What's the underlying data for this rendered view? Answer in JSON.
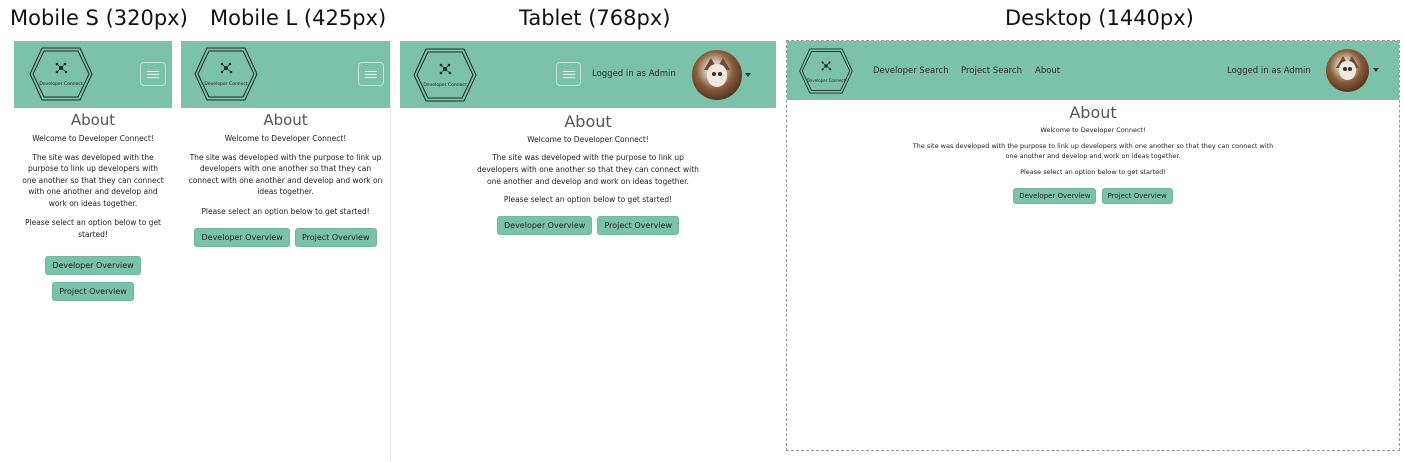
{
  "titles": {
    "mobile_s": "Mobile S (320px)",
    "mobile_l": "Mobile L (425px)",
    "tablet": "Tablet (768px)",
    "desktop": "Desktop (1440px)"
  },
  "brand": {
    "logo_text": "Developer Connect",
    "navbar_color": "#7cc1a9",
    "button_color": "#7cc1a9"
  },
  "nav": {
    "developer_search": "Developer Search",
    "project_search": "Project Search",
    "about": "About",
    "logged_in": "Logged in as Admin"
  },
  "about": {
    "heading": "About",
    "welcome": "Welcome to Developer Connect!",
    "description": "The site was developed with the purpose to link up developers with one another so that they can connect with one another and develop and work on ideas together.",
    "prompt": "Please select an option below to get started!",
    "developer_button": "Developer Overview",
    "project_button": "Project Overview"
  },
  "icons": {
    "menu": "hamburger-menu-icon",
    "logo": "hexagon-network-logo",
    "avatar": "cat-avatar",
    "dropdown": "caret-down-icon"
  }
}
